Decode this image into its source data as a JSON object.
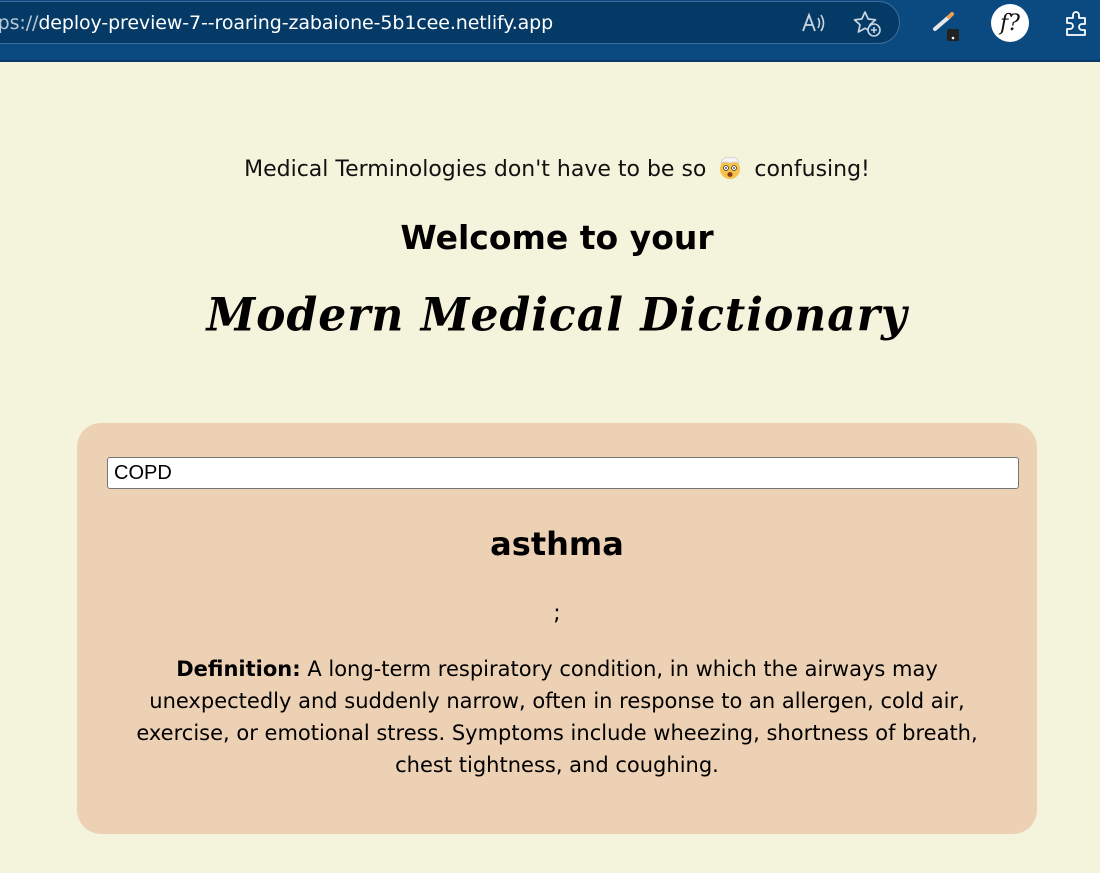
{
  "browser": {
    "url_scheme": "https://",
    "url_host": "deploy-preview-7--roaring-zabaione-5b1cee.netlify.app",
    "icons": [
      "read-aloud-icon",
      "add-favorite-icon",
      "extension-pen-icon",
      "font-identifier-icon",
      "extensions-puzzle-icon"
    ],
    "font_ext_label": "f?"
  },
  "header": {
    "tagline_before": "Medical Terminologies don't have to be so",
    "tagline_emoji": "🤯",
    "tagline_after": "confusing!",
    "welcome": "Welcome to your",
    "title": "Modern Medical Dictionary"
  },
  "search": {
    "value": "COPD"
  },
  "result": {
    "term": "asthma",
    "phonetic": ";",
    "definition_label": "Definition:",
    "definition_text": "A long-term respiratory condition, in which the airways may unexpectedly and suddenly narrow, often in response to an allergen, cold air, exercise, or emotional stress. Symptoms include wheezing, shortness of breath, chest tightness, and coughing."
  },
  "colors": {
    "page_background": "#f4f4dc",
    "card_background": "#edd1b4",
    "browser_bar": "#0b4a80"
  }
}
